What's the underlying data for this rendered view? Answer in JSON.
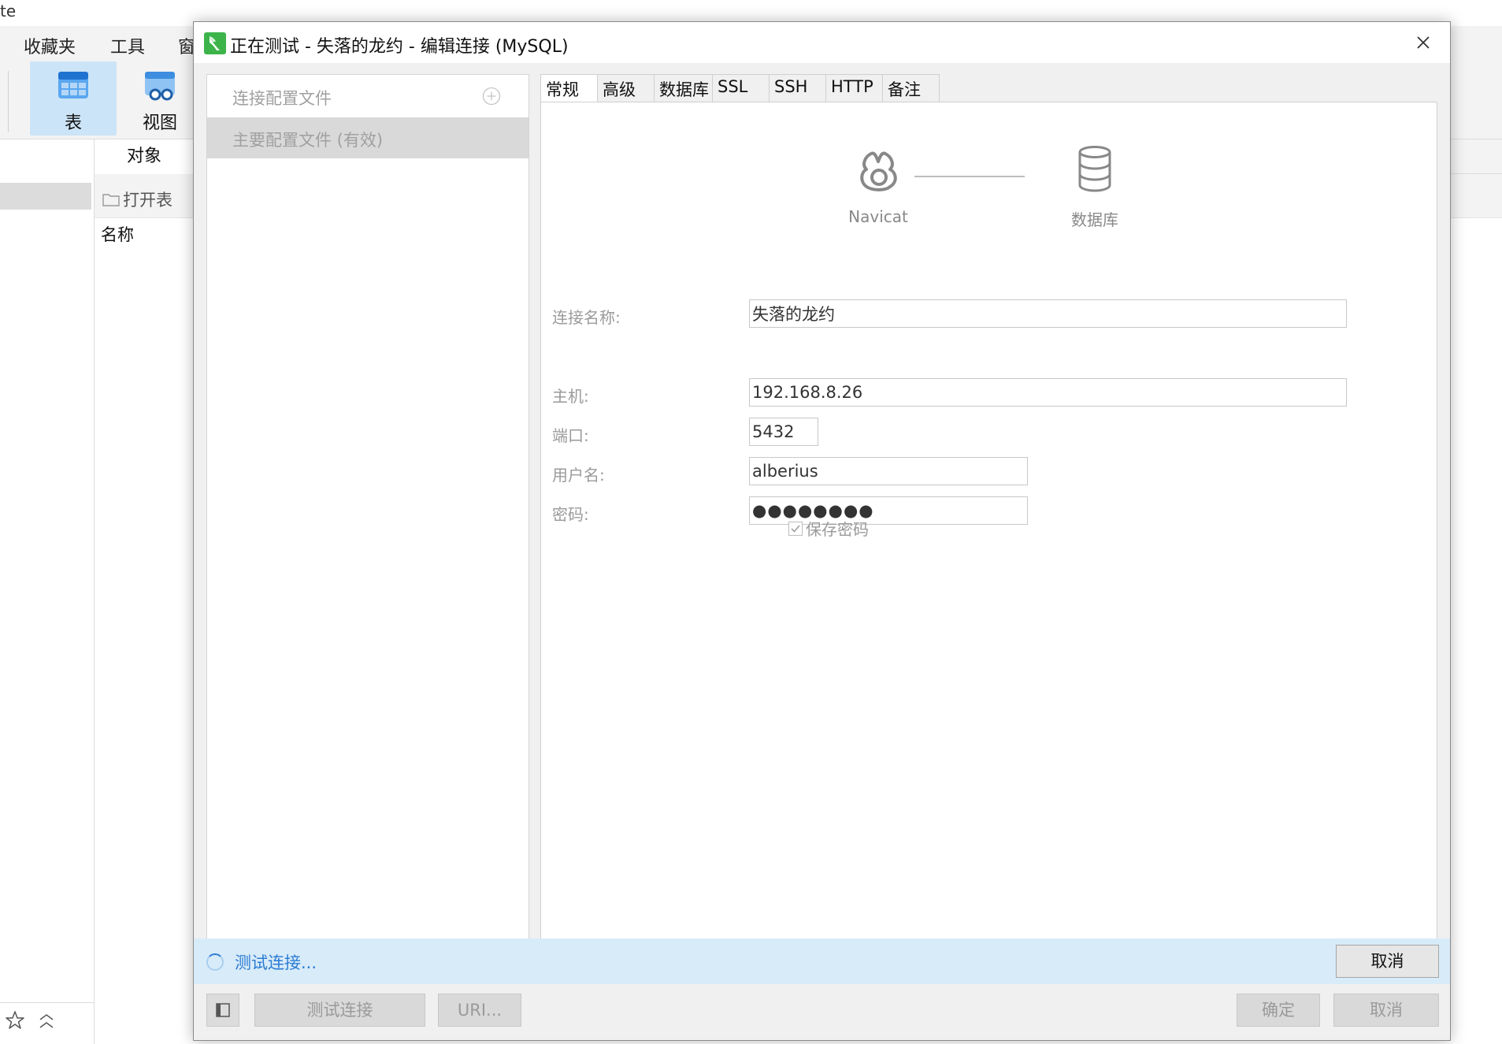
{
  "background_app": {
    "title_fragment": "te",
    "menu": [
      {
        "label": "收藏夹"
      },
      {
        "label": "工具"
      },
      {
        "label": "窗"
      }
    ],
    "toolbar": [
      {
        "label": "表",
        "icon": "table-icon",
        "active": true
      },
      {
        "label": "视图",
        "icon": "view-icon",
        "active": false
      }
    ],
    "object_tab": "对象",
    "open_table": "打开表",
    "column_header": "名称"
  },
  "dialog": {
    "title": "正在测试 - 失落的龙约 - 编辑连接 (MySQL)",
    "profile_panel": {
      "header": "连接配置文件",
      "items": [
        {
          "label": "主要配置文件 (有效)"
        }
      ]
    },
    "tabs": [
      {
        "label": "常规",
        "active": true
      },
      {
        "label": "高级",
        "active": false
      },
      {
        "label": "数据库",
        "active": false
      },
      {
        "label": "SSL",
        "active": false
      },
      {
        "label": "SSH",
        "active": false
      },
      {
        "label": "HTTP",
        "active": false
      },
      {
        "label": "备注",
        "active": false
      }
    ],
    "diagram": {
      "left_label": "Navicat",
      "right_label": "数据库"
    },
    "form": {
      "connection_name_label": "连接名称:",
      "connection_name_value": "失落的龙约",
      "host_label": "主机:",
      "host_value": "192.168.8.26",
      "port_label": "端口:",
      "port_value": "5432",
      "username_label": "用户名:",
      "username_value": "alberius",
      "password_label": "密码:",
      "password_value": "●●●●●●●●",
      "save_password_label": "保存密码",
      "save_password_checked": true
    },
    "status": {
      "text": "测试连接...",
      "cancel_label": "取消"
    },
    "buttons": {
      "test_connection": "测试连接",
      "uri": "URI...",
      "ok": "确定",
      "cancel": "取消"
    },
    "colors": {
      "accent": "#2b7cd3",
      "status_bg": "#d8ebf9",
      "logo_green": "#3cb44a"
    }
  }
}
